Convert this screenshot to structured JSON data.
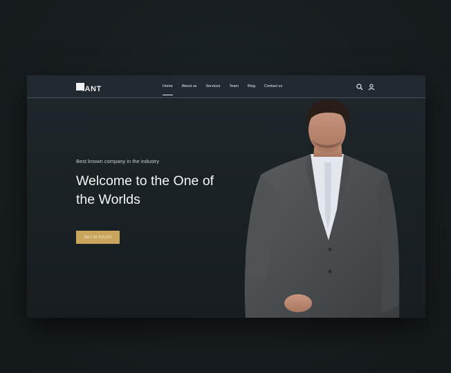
{
  "brand": {
    "logo_text": "IANT"
  },
  "nav": {
    "items": [
      {
        "label": "Home",
        "active": true
      },
      {
        "label": "About us",
        "active": false
      },
      {
        "label": "Services",
        "active": false
      },
      {
        "label": "Team",
        "active": false
      },
      {
        "label": "Blog",
        "active": false
      },
      {
        "label": "Contact us",
        "active": false
      }
    ],
    "icons": [
      "search-icon",
      "user-icon"
    ]
  },
  "hero": {
    "tagline": "Best known company in the industry",
    "headline": "Welcome to the One of the Worlds",
    "cta_label": "GET IN TOUCH"
  },
  "colors": {
    "accent": "#c9a55e",
    "background": "#1b2226",
    "text": "#f4f5f6"
  }
}
